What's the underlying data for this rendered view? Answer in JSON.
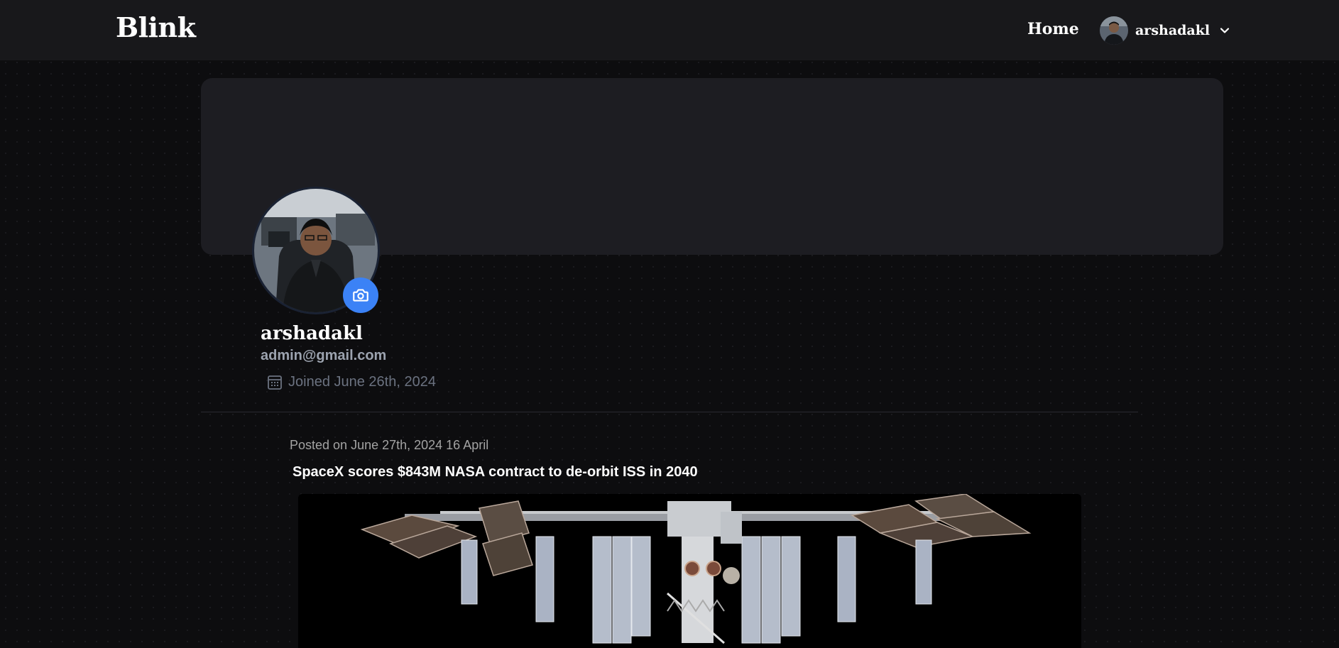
{
  "header": {
    "logo": "Blink",
    "nav_home": "Home",
    "user_name": "arshadakl"
  },
  "profile": {
    "name": "arshadakl",
    "email": "admin@gmail.com",
    "joined": "Joined June 26th, 2024"
  },
  "post": {
    "meta": "Posted on June 27th, 2024 16 April",
    "title": "SpaceX scores $843M NASA contract to de-orbit ISS in 2040"
  },
  "icons": {
    "chevron": "chevron-down-icon",
    "camera": "camera-icon",
    "calendar": "calendar-icon"
  },
  "colors": {
    "accent": "#3b82f6",
    "background": "#0d0d0f",
    "topbar": "#18181b",
    "banner": "#1d1d22"
  }
}
